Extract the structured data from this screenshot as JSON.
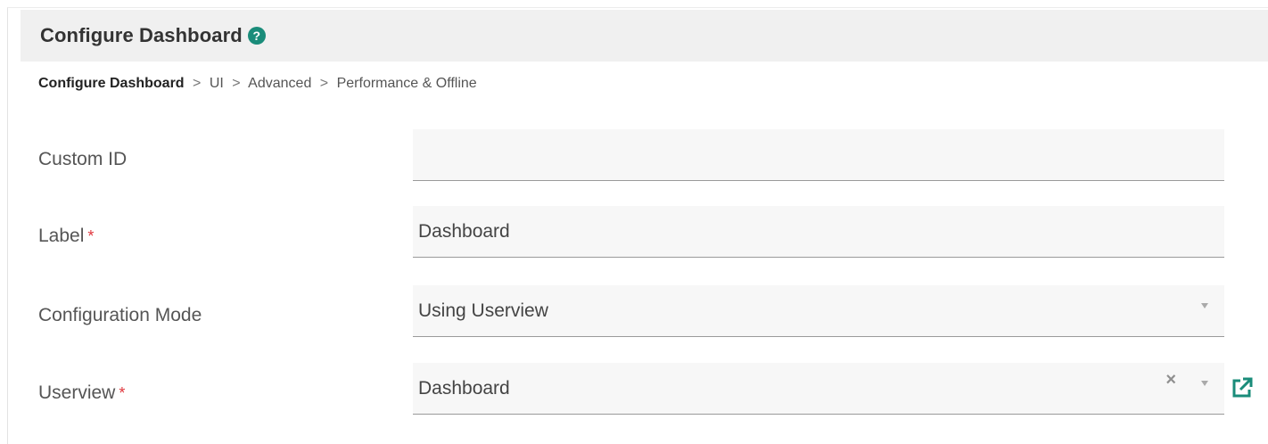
{
  "header": {
    "title": "Configure Dashboard",
    "help_icon": "question-circle-icon",
    "help_glyph": "?"
  },
  "breadcrumb": {
    "root": "Configure Dashboard",
    "separator": ">",
    "items": [
      "UI",
      "Advanced",
      "Performance & Offline"
    ]
  },
  "form": {
    "custom_id": {
      "label": "Custom ID",
      "value": ""
    },
    "label": {
      "label": "Label",
      "required_mark": "*",
      "value": "Dashboard"
    },
    "configuration_mode": {
      "label": "Configuration Mode",
      "value": "Using Userview"
    },
    "userview": {
      "label": "Userview",
      "required_mark": "*",
      "value": "Dashboard",
      "clear_glyph": "×",
      "open_icon": "external-link-icon"
    }
  },
  "colors": {
    "accent": "#1a8c7a",
    "required": "#e0383e",
    "header_bg": "#f0f0f0",
    "field_bg": "#f7f7f7"
  }
}
